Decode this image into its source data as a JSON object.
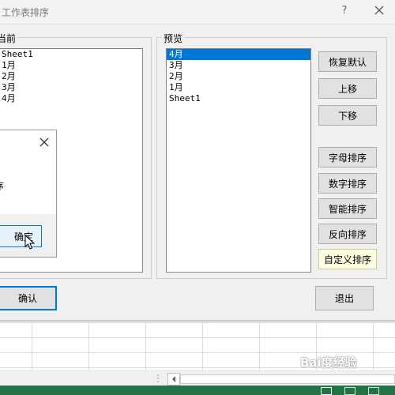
{
  "dialog": {
    "title": "工作表排序",
    "help_symbol": "?",
    "current_label": "当前",
    "preview_label": "预览",
    "current_items": [
      "Sheet1",
      "1月",
      "2月",
      "3月",
      "4月"
    ],
    "preview_items": [
      "4月",
      "3月",
      "2月",
      "1月",
      "Sheet1"
    ],
    "preview_selected_index": 0,
    "buttons": {
      "restore_default": "恢复默认",
      "move_up": "上移",
      "move_down": "下移",
      "alpha_sort": "字母排序",
      "numeric_sort": "数字排序",
      "smart_sort": "智能排序",
      "reverse_sort": "反向排序",
      "custom_sort": "自定义排序",
      "confirm": "确认",
      "exit": "退出"
    }
  },
  "popup": {
    "text_fragment": "序",
    "ok_label": "确定"
  },
  "watermark": "Bai度经验"
}
